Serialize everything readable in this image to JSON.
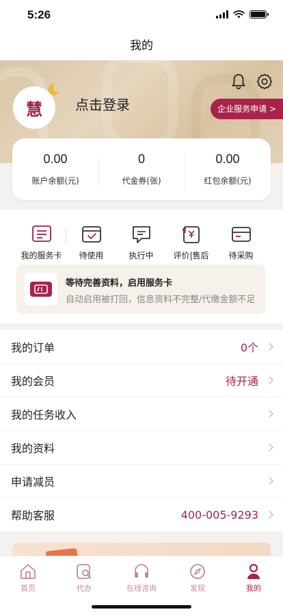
{
  "status_bar": {
    "time": "5:26"
  },
  "nav": {
    "title": "我的"
  },
  "profile": {
    "avatar_glyph": "慧",
    "login_text": "点击登录",
    "enterprise_button": "企业服务申请 >"
  },
  "wallet": [
    {
      "value": "0.00",
      "label": "账户余额(元)"
    },
    {
      "value": "0",
      "label": "代金券(张)"
    },
    {
      "value": "0.00",
      "label": "红包余额(元)"
    }
  ],
  "services": [
    {
      "label": "我的服务卡",
      "icon": "service-card-icon"
    },
    {
      "label": "待使用",
      "icon": "pending-use-icon"
    },
    {
      "label": "执行中",
      "icon": "in-progress-icon"
    },
    {
      "label": "评价|售后",
      "icon": "after-sales-icon"
    },
    {
      "label": "待采购",
      "icon": "pending-purchase-icon"
    }
  ],
  "notice": {
    "title": "等待完善资料，启用服务卡",
    "description": "自动启用被打回，信息资料不完整/代缴金额不足"
  },
  "menu": [
    {
      "label": "我的订单",
      "value": "0个"
    },
    {
      "label": "我的会员",
      "value": "待开通"
    },
    {
      "label": "我的任务收入",
      "value": ""
    },
    {
      "label": "我的资料",
      "value": ""
    },
    {
      "label": "申请减员",
      "value": ""
    },
    {
      "label": "帮助客服",
      "value": "400-005-9293"
    }
  ],
  "tabs": [
    {
      "label": "首页",
      "icon": "home-icon"
    },
    {
      "label": "代办",
      "icon": "agent-search-icon"
    },
    {
      "label": "在线咨询",
      "icon": "headset-icon"
    },
    {
      "label": "发现",
      "icon": "compass-icon"
    },
    {
      "label": "我的",
      "icon": "profile-icon",
      "active": true
    }
  ],
  "colors": {
    "brand": "#a8234a",
    "hero_bg": "#ddc9ab",
    "tab_inactive": "#c48a98"
  }
}
